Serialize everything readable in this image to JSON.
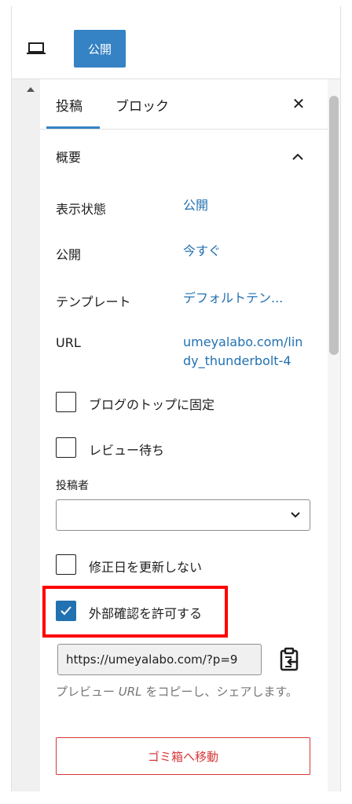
{
  "toolbar": {
    "preview_icon": "laptop-icon",
    "publish_label": "公開"
  },
  "tabs": [
    {
      "label": "投稿",
      "active": true
    },
    {
      "label": "ブロック",
      "active": false
    }
  ],
  "close_symbol": "✕",
  "summary": {
    "title": "概要",
    "rows": [
      {
        "label": "表示状態",
        "value": "公開"
      },
      {
        "label": "公開",
        "value": "今すぐ"
      },
      {
        "label": "テンプレート",
        "value": "デフォルトテン..."
      },
      {
        "label": "URL",
        "value_line1": "umeyalabo.com/lin",
        "value_line2": "dy_thunderbolt-4"
      }
    ]
  },
  "checkboxes": {
    "sticky": {
      "label": "ブログのトップに固定",
      "checked": false
    },
    "pending": {
      "label": "レビュー待ち",
      "checked": false
    },
    "no_modified": {
      "label": "修正日を更新しない",
      "checked": false
    },
    "external_preview": {
      "label": "外部確認を許可する",
      "checked": true
    }
  },
  "author": {
    "label": "投稿者",
    "value": ""
  },
  "preview_link": {
    "url": "https://umeyalabo.com/?p=9",
    "help_before": "プレビュー ",
    "help_em": "URL",
    "help_after": " をコピーし、シェアします。"
  },
  "trash_label": "ゴミ箱へ移動",
  "colors": {
    "accent": "#3582c4",
    "link": "#2271b1",
    "danger": "#d63638",
    "highlight": "#ff0000"
  }
}
